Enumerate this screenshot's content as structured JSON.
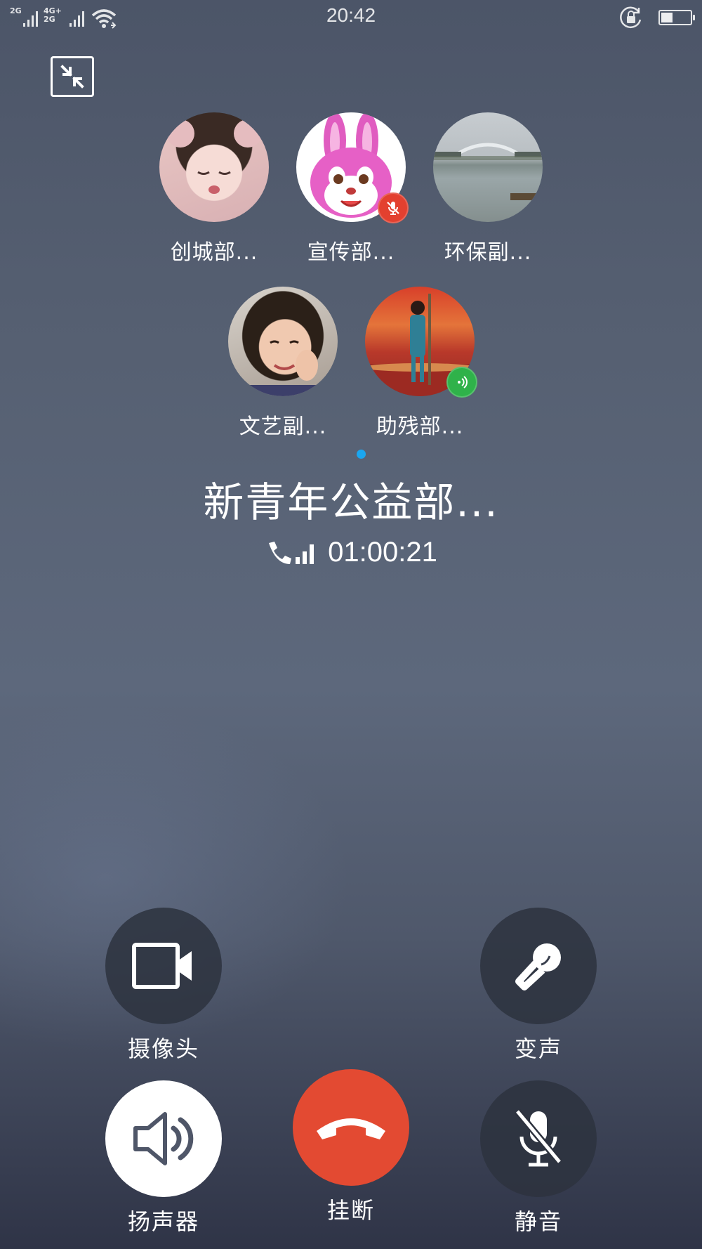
{
  "status_bar": {
    "time": "20:42",
    "sim1_tag": "2G",
    "sim2_tag_top": "4G+",
    "sim2_tag_bottom": "2G",
    "icons": [
      "signal-icon",
      "signal-icon",
      "wifi-icon",
      "rotation-lock-icon",
      "battery-icon"
    ],
    "battery_level": 0.4
  },
  "minimize": {
    "icon": "minimize-icon"
  },
  "participants": [
    {
      "name": "创城部...",
      "status": "none"
    },
    {
      "name": "宣传部...",
      "status": "muted"
    },
    {
      "name": "环保副...",
      "status": "none"
    },
    {
      "name": "文艺副...",
      "status": "none"
    },
    {
      "name": "助残部...",
      "status": "speaking"
    }
  ],
  "call": {
    "group_name": "新青年公益部...",
    "duration": "01:00:21",
    "page_indicator_color": "#1aa6f0"
  },
  "controls": {
    "camera_label": "摄像头",
    "voice_changer_label": "变声",
    "speaker_label": "扬声器",
    "hangup_label": "挂断",
    "mute_label": "静音",
    "hangup_color": "#e34a32"
  }
}
